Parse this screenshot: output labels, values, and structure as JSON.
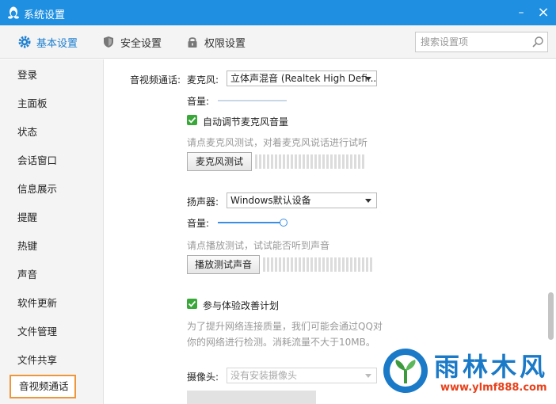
{
  "window": {
    "title": "系统设置",
    "minimize": "–",
    "close": "×"
  },
  "tabs": [
    {
      "label": "基本设置",
      "active": true,
      "icon": "gear-icon"
    },
    {
      "label": "安全设置",
      "active": false,
      "icon": "shield-icon"
    },
    {
      "label": "权限设置",
      "active": false,
      "icon": "lock-icon"
    }
  ],
  "search": {
    "placeholder": "搜索设置项",
    "icon": "search-icon"
  },
  "sidebar": {
    "items": [
      {
        "label": "登录"
      },
      {
        "label": "主面板"
      },
      {
        "label": "状态"
      },
      {
        "label": "会话窗口"
      },
      {
        "label": "信息展示"
      },
      {
        "label": "提醒"
      },
      {
        "label": "热键"
      },
      {
        "label": "声音"
      },
      {
        "label": "软件更新"
      },
      {
        "label": "文件管理"
      },
      {
        "label": "文件共享"
      },
      {
        "label": "音视频通话",
        "active": true
      }
    ]
  },
  "content": {
    "section_label": "音视频通话:",
    "mic": {
      "label": "麦克风:",
      "device": "立体声混音 (Realtek High Defi...",
      "volume_label": "音量:",
      "volume_level": 0,
      "auto_adjust_label": "自动调节麦克风音量",
      "auto_adjust_checked": true,
      "test_hint": "请点麦克风测试，对着麦克风说话进行试听",
      "test_button": "麦克风测试"
    },
    "speaker": {
      "label": "扬声器:",
      "device": "Windows默认设备",
      "volume_label": "音量:",
      "volume_level": 1.0,
      "test_hint": "请点播放测试，试试能否听到声音",
      "test_button": "播放测试声音"
    },
    "experience": {
      "label": "参与体验改善计划",
      "checked": true,
      "desc_line1": "为了提升网络连接质量，我们可能会通过QQ对",
      "desc_line2": "你的网络进行检测。消耗流量不大于10MB。"
    },
    "camera": {
      "label": "摄像头:",
      "device": "没有安装摄像头"
    }
  },
  "watermark": {
    "title": "雨林木风",
    "url": "www.ylmf888.com"
  },
  "colors": {
    "titlebar": "#1e8fe1",
    "accent": "#1e7fd0",
    "check": "#39a839",
    "highlight_border": "#f0963a"
  }
}
